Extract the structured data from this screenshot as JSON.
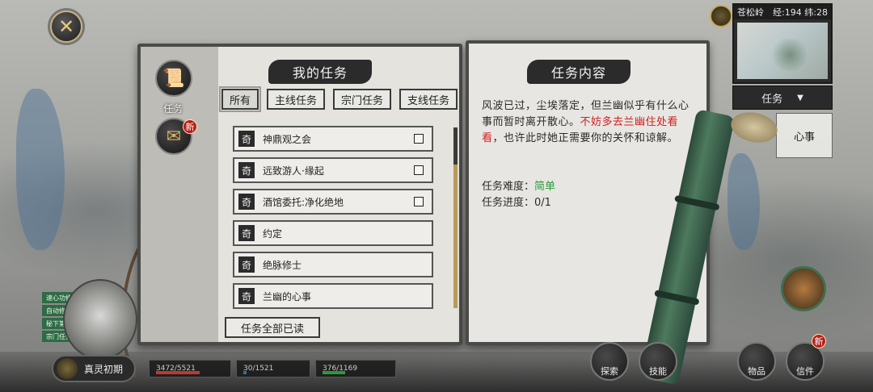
{
  "window": {
    "close_symbol": "✕"
  },
  "minimap": {
    "location": "苍松岭",
    "coords": "经:194 纬:28"
  },
  "right_hud": {
    "task_dropdown_label": "任务",
    "side_task_text": "心事"
  },
  "side_menu": {
    "items": [
      {
        "label": "任务",
        "icon": "scroll-icon"
      },
      {
        "label": "",
        "icon": "letter-icon",
        "badge": "新"
      }
    ]
  },
  "quest_list": {
    "title": "我的任务",
    "tabs": [
      "所有",
      "主线任务",
      "宗门任务",
      "支线任务"
    ],
    "active_tab": "所有",
    "rows": [
      {
        "tag": "奇",
        "name": "神鼎观之会",
        "has_checkbox": true
      },
      {
        "tag": "奇",
        "name": "远致游人·缘起",
        "has_checkbox": true
      },
      {
        "tag": "奇",
        "name": "酒馆委托:净化绝地",
        "has_checkbox": true
      },
      {
        "tag": "奇",
        "name": "约定",
        "has_checkbox": false
      },
      {
        "tag": "奇",
        "name": "绝脉修士",
        "has_checkbox": false
      },
      {
        "tag": "奇",
        "name": "兰幽的心事",
        "has_checkbox": false
      }
    ],
    "mark_all_read": "任务全部已读"
  },
  "quest_detail": {
    "title": "任务内容",
    "desc_part1": "风波已过，尘埃落定，但兰幽似乎有什么心事而暂时离开散心。",
    "desc_highlight": "不妨多去兰幽住处看看",
    "desc_part2": "，也许此时她正需要你的关怀和谅解。",
    "difficulty_label": "任务难度：",
    "difficulty_value": "简单",
    "progress_label": "任务进度：",
    "progress_value": "0/1"
  },
  "character": {
    "realm": "真灵初期",
    "quick_buttons": [
      "速心功修",
      "自动修炼",
      "秘下第一",
      "宗门任务"
    ],
    "stats": [
      {
        "value": "3472/5521",
        "color": "#c0392b"
      },
      {
        "value": "30/1521",
        "color": "#2f6fb0"
      },
      {
        "value": "376/1169",
        "color": "#2a9a3a"
      }
    ]
  },
  "bottom_nav": {
    "items": [
      "探索",
      "技能",
      "物品",
      "信件"
    ],
    "badge": "新"
  },
  "colors": {
    "highlight_red": "#d11f1f",
    "easy_green": "#2a9a3a",
    "ink": "#2b2b2b"
  }
}
